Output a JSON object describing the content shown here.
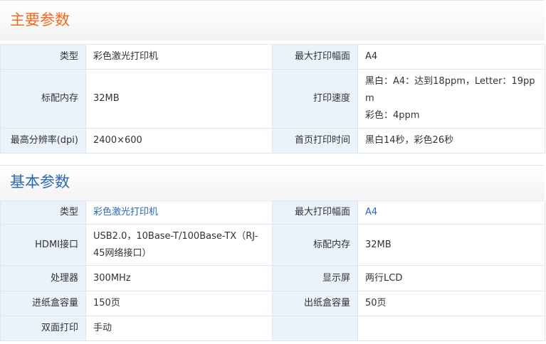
{
  "main_params": {
    "title": "主要参数",
    "rows": [
      {
        "label1": "类型",
        "value1": "彩色激光打印机",
        "label2": "最大打印幅面",
        "value2": "A4"
      },
      {
        "label1": "标配内存",
        "value1": "32MB",
        "label2": "打印速度",
        "value2_line1": "黑白：A4：达到18ppm，Letter：19pp",
        "value2_line2": "m",
        "value2_line3": "彩色：4ppm"
      },
      {
        "label1": "最高分辨率(dpi)",
        "value1": "2400×600",
        "label2": "首页打印时间",
        "value2": "黑白14秒，彩色26秒"
      }
    ]
  },
  "basic_params": {
    "title": "基本参数",
    "rows": [
      {
        "label1": "类型",
        "value1": "彩色激光打印机",
        "label2": "最大打印幅面",
        "value2": "A4"
      },
      {
        "label1": "HDMI接口",
        "value1_line1": "USB2.0，10Base-T/100Base-TX（RJ-",
        "value1_line2": "45网络接口）",
        "label2": "标配内存",
        "value2": "32MB"
      },
      {
        "label1": "处理器",
        "value1": "300MHz",
        "label2": "显示屏",
        "value2": "两行LCD"
      },
      {
        "label1": "进纸盒容量",
        "value1": "150页",
        "label2": "出纸盒容量",
        "value2": "50页"
      },
      {
        "label1": "双面打印",
        "value1": "手动",
        "label2": "",
        "value2": ""
      }
    ]
  },
  "colors": {
    "title_main": "#f26b1d",
    "title_basic": "#2c68b3",
    "label_bg": "#eaf2fb",
    "border": "#dce6f2"
  }
}
